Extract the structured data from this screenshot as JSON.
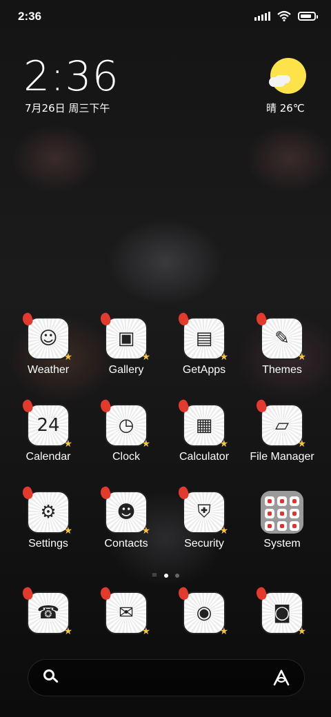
{
  "status_bar": {
    "time": "2:36",
    "battery_level": 0.85
  },
  "clock_widget": {
    "time": "2:36",
    "date": "7月26日 周三下午"
  },
  "weather_widget": {
    "text": "晴 26℃",
    "icon": "sun-cloud-icon"
  },
  "apps": [
    {
      "label": "Weather",
      "icon": "weather-face-icon",
      "glyph": "☺"
    },
    {
      "label": "Gallery",
      "icon": "gallery-icon",
      "glyph": "▣"
    },
    {
      "label": "GetApps",
      "icon": "getapps-icon",
      "glyph": "▤"
    },
    {
      "label": "Themes",
      "icon": "brush-icon",
      "glyph": "✎"
    },
    {
      "label": "Calendar",
      "icon": "calendar-icon",
      "glyph": "24"
    },
    {
      "label": "Clock",
      "icon": "clock-icon",
      "glyph": "◷"
    },
    {
      "label": "Calculator",
      "icon": "calculator-icon",
      "glyph": "▦"
    },
    {
      "label": "File Manager",
      "icon": "folder-icon",
      "glyph": "▱"
    },
    {
      "label": "Settings",
      "icon": "gear-icon",
      "glyph": "⚙"
    },
    {
      "label": "Contacts",
      "icon": "contacts-icon",
      "glyph": "☻"
    },
    {
      "label": "Security",
      "icon": "shield-icon",
      "glyph": "⛨"
    },
    {
      "label": "System",
      "icon": "folder-grid-icon",
      "glyph": ""
    }
  ],
  "dock": [
    {
      "icon": "phone-icon",
      "glyph": "☎"
    },
    {
      "icon": "message-icon",
      "glyph": "✉"
    },
    {
      "icon": "browser-icon",
      "glyph": "◉"
    },
    {
      "icon": "camera-icon",
      "glyph": "◙"
    }
  ],
  "colors": {
    "flame": "#e23b2e",
    "sun": "#fde24a",
    "star": "#f5c542"
  }
}
